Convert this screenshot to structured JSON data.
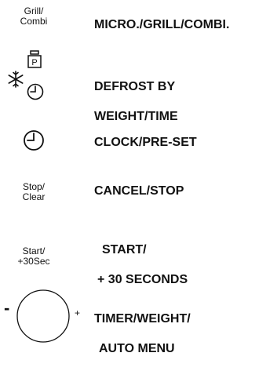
{
  "rows": {
    "grill": {
      "button_label_line1": "Grill/",
      "button_label_line2": "Combi",
      "description": "MICRO./GRILL/COMBI."
    },
    "defrost": {
      "weight_icon_letter": "P",
      "description_line1": "DEFROST BY",
      "description_line2": "WEIGHT/TIME",
      "icons": [
        "snowflake-icon",
        "weight-icon",
        "clock-icon"
      ]
    },
    "clock": {
      "description": "CLOCK/PRE-SET",
      "icons": [
        "clock-icon"
      ]
    },
    "stop": {
      "button_label_line1": "Stop/",
      "button_label_line2": "Clear",
      "description": "CANCEL/STOP"
    },
    "start": {
      "button_label_line1": "Start/",
      "button_label_line2": "+30Sec",
      "description_line1": "START/",
      "description_line2": "+ 30 SECONDS"
    },
    "knob": {
      "minus_label": "-",
      "plus_label": "+",
      "description_line1": "TIMER/WEIGHT/",
      "description_line2": "AUTO MENU",
      "icons": [
        "dial-knob"
      ]
    }
  },
  "colors": {
    "ink": "#111111",
    "background": "#ffffff"
  }
}
